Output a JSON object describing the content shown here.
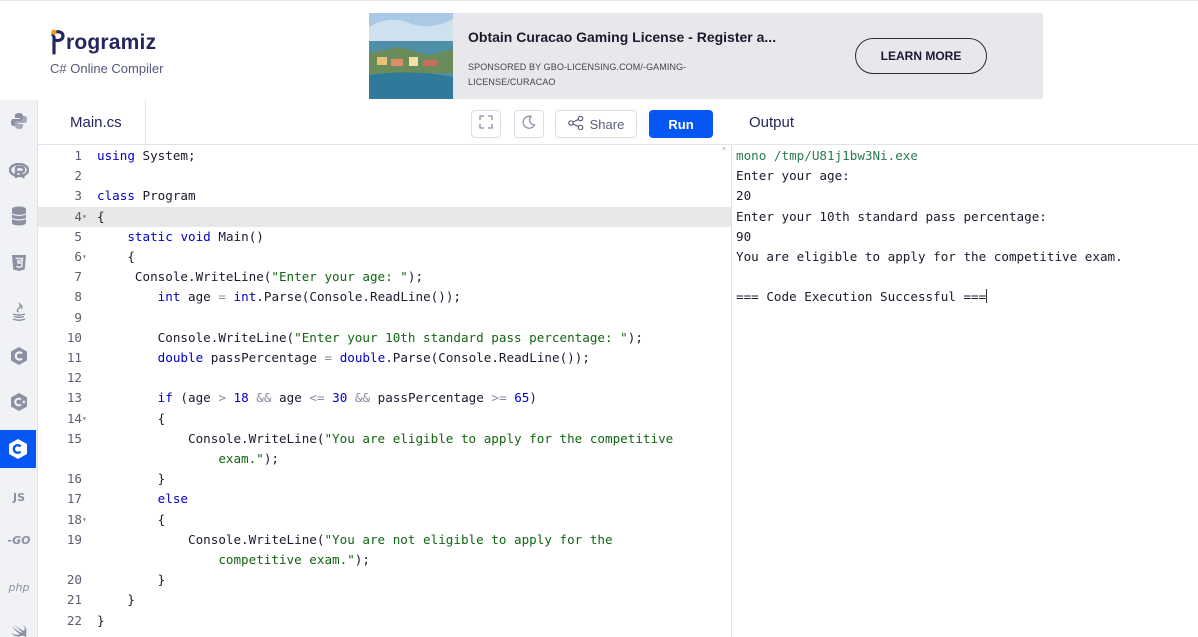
{
  "header": {
    "logo_text": "rogramiz",
    "subtitle": "C# Online Compiler"
  },
  "ad": {
    "title": "Obtain Curacao Gaming License - Register a...",
    "sponsor": "SPONSORED BY GBO-LICENSING.COM/-GAMING-LICENSE/CURACAO",
    "button": "LEARN MORE"
  },
  "sidebar": {
    "items": [
      {
        "name": "python",
        "icon": "python-icon"
      },
      {
        "name": "r",
        "icon": "r-lang-icon"
      },
      {
        "name": "sql",
        "icon": "database-icon"
      },
      {
        "name": "html",
        "icon": "html5-icon"
      },
      {
        "name": "java",
        "icon": "java-icon"
      },
      {
        "name": "c",
        "icon": "c-lang-icon"
      },
      {
        "name": "cpp",
        "icon": "cpp-icon"
      },
      {
        "name": "csharp",
        "icon": "csharp-icon",
        "active": true
      },
      {
        "name": "js",
        "label": "JS"
      },
      {
        "name": "go",
        "label": "-GO"
      },
      {
        "name": "php",
        "label": "php"
      },
      {
        "name": "swift",
        "icon": "swift-icon"
      }
    ]
  },
  "editor": {
    "tab": "Main.cs",
    "share_label": "Share",
    "run_label": "Run",
    "highlighted_line": "4"
  },
  "code": [
    {
      "n": "1",
      "fold": false,
      "segs": [
        [
          "kw",
          "using"
        ],
        [
          "plain",
          " System;"
        ]
      ]
    },
    {
      "n": "2",
      "fold": false,
      "segs": []
    },
    {
      "n": "3",
      "fold": false,
      "segs": [
        [
          "kw",
          "class"
        ],
        [
          "plain",
          " Program"
        ]
      ]
    },
    {
      "n": "4",
      "fold": true,
      "segs": [
        [
          "plain",
          "{"
        ]
      ]
    },
    {
      "n": "5",
      "fold": false,
      "segs": [
        [
          "plain",
          "    "
        ],
        [
          "kw",
          "static"
        ],
        [
          "plain",
          " "
        ],
        [
          "kw",
          "void"
        ],
        [
          "plain",
          " Main()"
        ]
      ]
    },
    {
      "n": "6",
      "fold": true,
      "segs": [
        [
          "plain",
          "    {"
        ]
      ]
    },
    {
      "n": "7",
      "fold": false,
      "segs": [
        [
          "plain",
          "     Console.WriteLine("
        ],
        [
          "str",
          "\"Enter your age: \""
        ],
        [
          "plain",
          ");"
        ]
      ]
    },
    {
      "n": "8",
      "fold": false,
      "segs": [
        [
          "plain",
          "        "
        ],
        [
          "kw",
          "int"
        ],
        [
          "plain",
          " age "
        ],
        [
          "op",
          "="
        ],
        [
          "plain",
          " "
        ],
        [
          "kw",
          "int"
        ],
        [
          "plain",
          ".Parse(Console.ReadLine());"
        ]
      ]
    },
    {
      "n": "9",
      "fold": false,
      "segs": []
    },
    {
      "n": "10",
      "fold": false,
      "segs": [
        [
          "plain",
          "        Console.WriteLine("
        ],
        [
          "str",
          "\"Enter your 10th standard pass percentage: \""
        ],
        [
          "plain",
          ");"
        ]
      ]
    },
    {
      "n": "11",
      "fold": false,
      "segs": [
        [
          "plain",
          "        "
        ],
        [
          "kw",
          "double"
        ],
        [
          "plain",
          " passPercentage "
        ],
        [
          "op",
          "="
        ],
        [
          "plain",
          " "
        ],
        [
          "kw",
          "double"
        ],
        [
          "plain",
          ".Parse(Console.ReadLine());"
        ]
      ]
    },
    {
      "n": "12",
      "fold": false,
      "segs": []
    },
    {
      "n": "13",
      "fold": false,
      "segs": [
        [
          "plain",
          "        "
        ],
        [
          "kw",
          "if"
        ],
        [
          "plain",
          " (age "
        ],
        [
          "op",
          ">"
        ],
        [
          "plain",
          " "
        ],
        [
          "num",
          "18"
        ],
        [
          "plain",
          " "
        ],
        [
          "op",
          "&&"
        ],
        [
          "plain",
          " age "
        ],
        [
          "op",
          "<="
        ],
        [
          "plain",
          " "
        ],
        [
          "num",
          "30"
        ],
        [
          "plain",
          " "
        ],
        [
          "op",
          "&&"
        ],
        [
          "plain",
          " passPercentage "
        ],
        [
          "op",
          ">="
        ],
        [
          "plain",
          " "
        ],
        [
          "num",
          "65"
        ],
        [
          "plain",
          ")"
        ]
      ]
    },
    {
      "n": "14",
      "fold": true,
      "segs": [
        [
          "plain",
          "        {"
        ]
      ]
    },
    {
      "n": "15",
      "fold": false,
      "segs": [
        [
          "plain",
          "            Console.WriteLine("
        ],
        [
          "str",
          "\"You are eligible to apply for the competitive"
        ]
      ]
    },
    {
      "n": "",
      "fold": false,
      "segs": [
        [
          "str",
          "                exam.\""
        ],
        [
          "plain",
          ");"
        ]
      ]
    },
    {
      "n": "16",
      "fold": false,
      "segs": [
        [
          "plain",
          "        }"
        ]
      ]
    },
    {
      "n": "17",
      "fold": false,
      "segs": [
        [
          "plain",
          "        "
        ],
        [
          "kw",
          "else"
        ]
      ]
    },
    {
      "n": "18",
      "fold": true,
      "segs": [
        [
          "plain",
          "        {"
        ]
      ]
    },
    {
      "n": "19",
      "fold": false,
      "segs": [
        [
          "plain",
          "            Console.WriteLine("
        ],
        [
          "str",
          "\"You are not eligible to apply for the"
        ]
      ]
    },
    {
      "n": "",
      "fold": false,
      "segs": [
        [
          "str",
          "                competitive exam.\""
        ],
        [
          "plain",
          ");"
        ]
      ]
    },
    {
      "n": "20",
      "fold": false,
      "segs": [
        [
          "plain",
          "        }"
        ]
      ]
    },
    {
      "n": "21",
      "fold": false,
      "segs": [
        [
          "plain",
          "    }"
        ]
      ]
    },
    {
      "n": "22",
      "fold": false,
      "segs": [
        [
          "plain",
          "}"
        ]
      ]
    }
  ],
  "output": {
    "title": "Output",
    "lines": [
      {
        "text": "mono /tmp/U81j1bw3Ni.exe",
        "cls": "cmd"
      },
      {
        "text": "Enter your age:",
        "cls": ""
      },
      {
        "text": "20",
        "cls": ""
      },
      {
        "text": "Enter your 10th standard pass percentage:",
        "cls": ""
      },
      {
        "text": "90",
        "cls": ""
      },
      {
        "text": "You are eligible to apply for the competitive exam.",
        "cls": ""
      },
      {
        "text": "",
        "cls": ""
      },
      {
        "text": "=== Code Execution Successful ===",
        "cls": "caret"
      }
    ]
  },
  "colors": {
    "accent": "#0556f3",
    "keyword": "#0000cc",
    "string": "#116611",
    "highlight": "#e8e8e8"
  }
}
